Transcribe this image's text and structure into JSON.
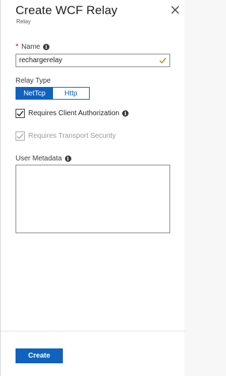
{
  "blade": {
    "title": "Create WCF Relay",
    "subtitle": "Relay",
    "close_icon": "close-icon"
  },
  "name_field": {
    "label": "Name",
    "required": true,
    "value": "rechargerelay",
    "valid_icon": "check-icon",
    "info_icon": "info-icon"
  },
  "relay_type": {
    "label": "Relay Type",
    "options": [
      "NetTcp",
      "Http"
    ],
    "selected": "NetTcp"
  },
  "requires_client_auth": {
    "label": "Requires Client Authorization",
    "checked": true,
    "disabled": false,
    "info_icon": "info-icon"
  },
  "requires_transport_security": {
    "label": "Requires Transport Security",
    "checked": true,
    "disabled": true
  },
  "user_metadata": {
    "label": "User Metadata",
    "value": "",
    "info_icon": "info-icon"
  },
  "footer": {
    "create_label": "Create"
  },
  "colors": {
    "accent": "#0f62be",
    "required": "#e81123",
    "valid": "#b8860b"
  }
}
